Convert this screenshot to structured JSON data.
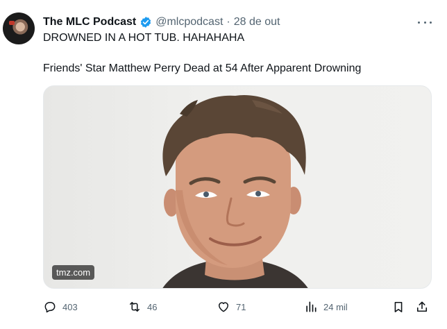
{
  "tweet": {
    "author": {
      "display_name": "The MLC Podcast",
      "handle": "@mlcpodcast",
      "verified": true,
      "verified_color": "#1d9bf0"
    },
    "separator": "·",
    "date": "28 de out",
    "text_line1": "DROWNED IN A HOT TUB. HAHAHAHA",
    "text_line2": "Friends' Star Matthew Perry Dead at 54 After Apparent Drowning",
    "media": {
      "source": "tmz.com"
    },
    "stats": {
      "replies": "403",
      "reposts": "46",
      "likes": "71",
      "views": "24 mil"
    },
    "icons": {
      "more": "more-options-icon",
      "reply": "reply-icon",
      "repost": "repost-icon",
      "like": "heart-icon",
      "views": "views-icon",
      "bookmark": "bookmark-icon",
      "share": "share-icon"
    }
  },
  "colors": {
    "text": "#0f1419",
    "muted": "#536471",
    "accent": "#1d9bf0",
    "background": "#ffffff"
  }
}
